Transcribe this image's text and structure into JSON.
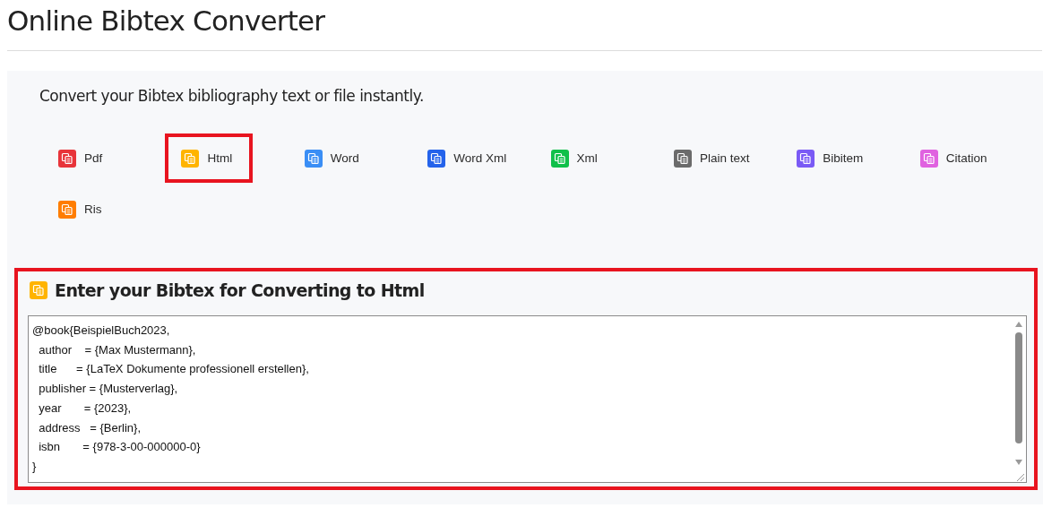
{
  "page": {
    "title": "Online Bibtex Converter"
  },
  "converter": {
    "subtitle": "Convert your Bibtex bibliography text or file instantly.",
    "formats": [
      {
        "label": "Pdf",
        "color": "#e8343a",
        "selected": false
      },
      {
        "label": "Html",
        "color": "#ffb400",
        "selected": true
      },
      {
        "label": "Word",
        "color": "#3a8ef5",
        "selected": false
      },
      {
        "label": "Word Xml",
        "color": "#2463eb",
        "selected": false
      },
      {
        "label": "Xml",
        "color": "#10c04a",
        "selected": false
      },
      {
        "label": "Plain text",
        "color": "#6b6b6b",
        "selected": false
      },
      {
        "label": "Bibitem",
        "color": "#7a5af5",
        "selected": false
      },
      {
        "label": "Citation",
        "color": "#e062e0",
        "selected": false
      },
      {
        "label": "Ris",
        "color": "#ff7d00",
        "selected": false
      }
    ]
  },
  "editor": {
    "heading": "Enter your Bibtex for Converting to Html",
    "color": "#ffb400",
    "lines": [
      "@book{BeispielBuch2023,",
      "  author    = {Max Mustermann},",
      "  title      = {LaTeX Dokumente professionell erstellen},",
      "  publisher = {Musterverlag},",
      "  year       = {2023},",
      "  address   = {Berlin},",
      "  isbn       = {978-3-00-000000-0}",
      "}"
    ]
  }
}
